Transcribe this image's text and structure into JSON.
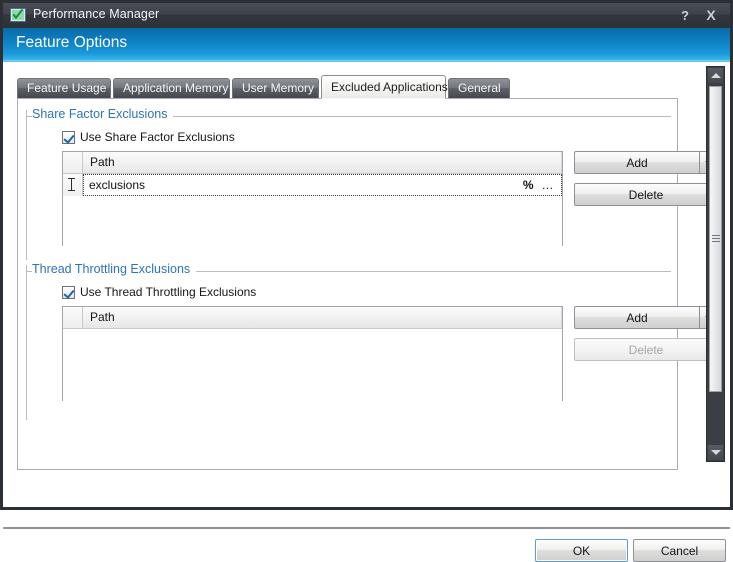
{
  "window": {
    "title": "Performance Manager",
    "icon": "app-checkmark-icon",
    "help_label": "?",
    "close_label": "X"
  },
  "banner": {
    "title": "Feature Options",
    "accent_color": "#1a9ada"
  },
  "tabs": [
    {
      "label": "Feature Usage",
      "selected": false
    },
    {
      "label": "Application Memory",
      "selected": false
    },
    {
      "label": "User Memory",
      "selected": false
    },
    {
      "label": "Excluded Applications",
      "selected": true
    },
    {
      "label": "General",
      "selected": false
    }
  ],
  "groups": {
    "share_factor": {
      "title": "Share Factor Exclusions",
      "title_color": "#2c74b8",
      "checkbox": {
        "label": "Use Share Factor Exclusions",
        "checked": true
      },
      "grid": {
        "columns": [
          "Path"
        ],
        "rows": [
          {
            "path": "exclusions",
            "editing": true,
            "percent_glyph": "%",
            "ellipsis_glyph": "…"
          }
        ]
      },
      "buttons": {
        "add": {
          "label": "Add",
          "enabled": true,
          "has_dropdown": true
        },
        "delete": {
          "label": "Delete",
          "enabled": true
        }
      }
    },
    "thread_throttling": {
      "title": "Thread Throttling Exclusions",
      "title_color": "#2c74b8",
      "checkbox": {
        "label": "Use Thread Throttling Exclusions",
        "checked": true
      },
      "grid": {
        "columns": [
          "Path"
        ],
        "rows": []
      },
      "buttons": {
        "add": {
          "label": "Add",
          "enabled": true,
          "has_dropdown": true
        },
        "delete": {
          "label": "Delete",
          "enabled": false
        }
      }
    }
  },
  "footer": {
    "ok_label": "OK",
    "cancel_label": "Cancel"
  },
  "scrollbar": {
    "up_arrow": "scroll-up-icon",
    "down_arrow": "scroll-down-icon"
  }
}
